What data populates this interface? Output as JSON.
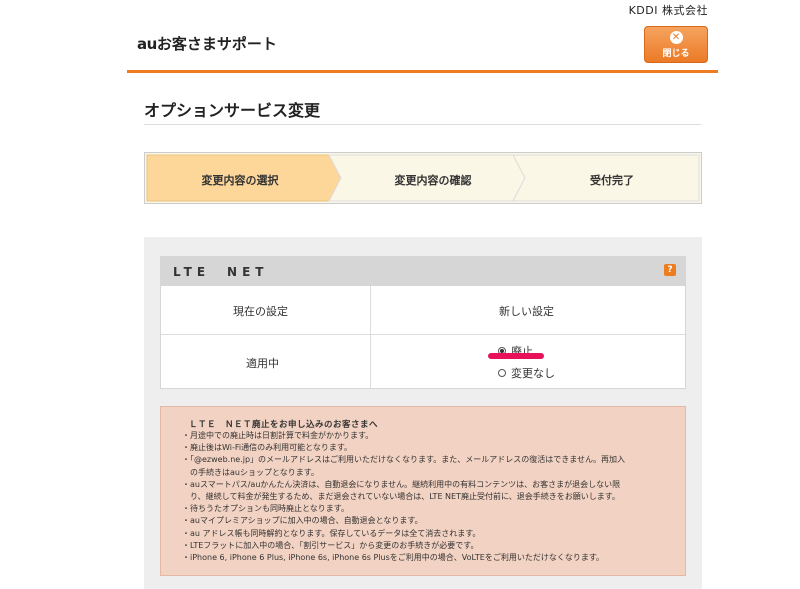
{
  "header": {
    "corp": "KDDI 株式会社",
    "brand_au": "au",
    "brand_rest": "お客さまサポート",
    "close_label": "閉じる",
    "close_icon": "close-circle-icon"
  },
  "page": {
    "title": "オプションサービス変更"
  },
  "steps": [
    {
      "label": "変更内容の選択",
      "active": true
    },
    {
      "label": "変更内容の確認",
      "active": false
    },
    {
      "label": "受付完了",
      "active": false
    }
  ],
  "service": {
    "name": "LTE　NET",
    "help": "?",
    "col_current": "現在の設定",
    "col_new": "新しい設定",
    "current_value": "適用中",
    "options": [
      {
        "label": "廃止",
        "selected": true
      },
      {
        "label": "変更なし",
        "selected": false
      }
    ]
  },
  "notice": {
    "title": "ＬＴＥ　ＮＥＴ廃止をお申し込みのお客さまへ",
    "items": [
      "・月途中での廃止時は日割計算で料金がかかります。",
      "・廃止後はWi-Fi通信のみ利用可能となります。",
      "・「@ezweb.ne.jp」のメールアドレスはご利用いただけなくなります。また、メールアドレスの復活はできません。再加入",
      "　の手続きはauショップとなります。",
      "・auスマートパス/auかんたん決済は、自動退会になりません。継続利用中の有料コンテンツは、お客さまが退会しない限",
      "　り、継続して料金が発生するため、まだ退会されていない場合は、LTE NET廃止受付前に、退会手続きをお願いします。",
      "・待ちうたオプションも同時廃止となります。",
      "・auマイプレミアショップに加入中の場合、自動退会となります。",
      "・au アドレス帳も同時解約となります。保存しているデータは全て消去されます。",
      "・LTEフラットに加入中の場合、「割引サービス」から変更のお手続きが必要です。",
      "・iPhone 6, iPhone 6 Plus, iPhone 6s, iPhone 6s Plusをご利用中の場合、VoLTEをご利用いただけなくなります。"
    ]
  },
  "colors": {
    "accent": "#ee7d22",
    "step_active": "#fdd79a",
    "step_inactive": "#fbf7e6",
    "highlight": "#e8125a"
  }
}
